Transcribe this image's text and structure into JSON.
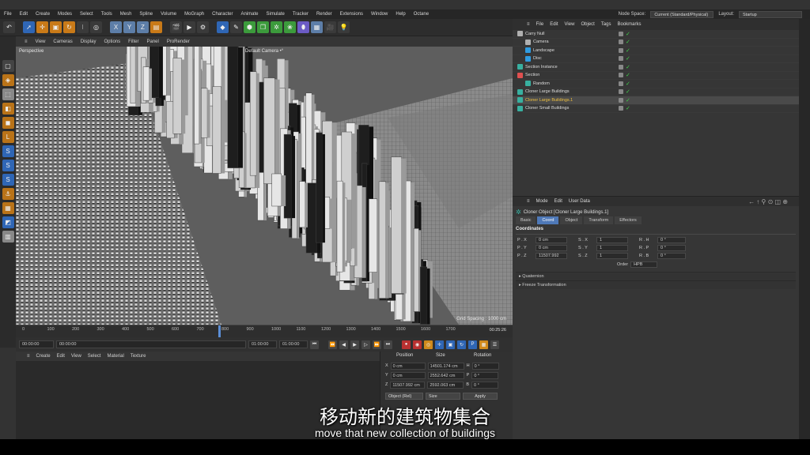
{
  "menu": {
    "items": [
      "File",
      "Edit",
      "Create",
      "Modes",
      "Select",
      "Tools",
      "Mesh",
      "Spline",
      "Volume",
      "MoGraph",
      "Character",
      "Animate",
      "Simulate",
      "Tracker",
      "Render",
      "Extensions",
      "Window",
      "Help",
      "Octane"
    ],
    "node_space_label": "Node Space:",
    "node_space_value": "Current (Standard/Physical)",
    "layout_label": "Layout:",
    "layout_value": "Startup"
  },
  "viewport": {
    "menu": [
      "View",
      "Cameras",
      "Display",
      "Options",
      "Filter",
      "Panel",
      "ProRender"
    ],
    "label": "Perspective",
    "camera": "Default Camera •°",
    "grid_spacing": "Grid Spacing : 1000 cm"
  },
  "timeline": {
    "ticks": [
      "0",
      "100",
      "200",
      "300",
      "400",
      "500",
      "600",
      "700",
      "800",
      "900",
      "1000",
      "1100",
      "1200",
      "1300",
      "1400",
      "1500",
      "1600",
      "1700"
    ],
    "current_frame": "00:25:26",
    "field_start": "00:00:00",
    "field_min": "00:00:00",
    "field_max": "01:00:00",
    "field_end": "01:00:00"
  },
  "materials": {
    "menu": [
      "Create",
      "Edit",
      "View",
      "Select",
      "Material",
      "Texture"
    ]
  },
  "coordinates": {
    "headers": [
      "Position",
      "Size",
      "Rotation"
    ],
    "rows": [
      {
        "axis": "X",
        "pos": "0 cm",
        "size": "14501.174 cm",
        "rot_label": "H",
        "rot": "0 °"
      },
      {
        "axis": "Y",
        "pos": "0 cm",
        "size": "2552.642 cm",
        "rot_label": "P",
        "rot": "0 °"
      },
      {
        "axis": "Z",
        "pos": "11507.992 cm",
        "size": "2592.063 cm",
        "rot_label": "B",
        "rot": "0 °"
      }
    ],
    "mode": "Object (Rel)",
    "size_mode": "Size",
    "apply": "Apply"
  },
  "objects": {
    "menu": [
      "File",
      "Edit",
      "View",
      "Object",
      "Tags",
      "Bookmarks"
    ],
    "items": [
      {
        "name": "Carry Null",
        "indent": 0,
        "color": "#b0b0b0",
        "selected": false
      },
      {
        "name": "Camera",
        "indent": 1,
        "color": "#b0b0b0",
        "selected": false
      },
      {
        "name": "Landscape",
        "indent": 1,
        "color": "#2f9be0",
        "selected": false
      },
      {
        "name": "Disc",
        "indent": 1,
        "color": "#2f9be0",
        "selected": false
      },
      {
        "name": "Section Instance",
        "indent": 0,
        "color": "#38b0a0",
        "selected": false
      },
      {
        "name": "Section",
        "indent": 0,
        "color": "#e05050",
        "selected": false
      },
      {
        "name": "Random",
        "indent": 1,
        "color": "#38b0a0",
        "selected": false
      },
      {
        "name": "Cloner Large Buildings",
        "indent": 0,
        "color": "#38b0a0",
        "selected": false
      },
      {
        "name": "Cloner Large Buildings.1",
        "indent": 0,
        "color": "#38b0a0",
        "selected": true
      },
      {
        "name": "Cloner Small Buildings",
        "indent": 0,
        "color": "#38b0a0",
        "selected": false
      }
    ]
  },
  "attributes": {
    "menu": [
      "Mode",
      "Edit",
      "User Data"
    ],
    "title": "Cloner Object [Cloner Large Buildings.1]",
    "tabs": [
      "Basic",
      "Coord",
      "Object",
      "Transform",
      "Effectors"
    ],
    "active_tab": "Coord",
    "section": "Coordinates",
    "rows": [
      {
        "p_label": "P . X",
        "p": "0 cm",
        "s_label": "S . X",
        "s": "1",
        "r_label": "R . H",
        "r": "0 °"
      },
      {
        "p_label": "P . Y",
        "p": "0 cm",
        "s_label": "S . Y",
        "s": "1",
        "r_label": "R . P",
        "r": "0 °"
      },
      {
        "p_label": "P . Z",
        "p": "11507.992",
        "s_label": "S . Z",
        "s": "1",
        "r_label": "R . B",
        "r": "0 °"
      }
    ],
    "order_label": "Order",
    "order_value": "HPB",
    "groups": [
      "Quaternion",
      "Freeze Transformation"
    ]
  },
  "subtitle": {
    "zh": "移动新的建筑物集合",
    "en": "move that new collection of buildings"
  }
}
